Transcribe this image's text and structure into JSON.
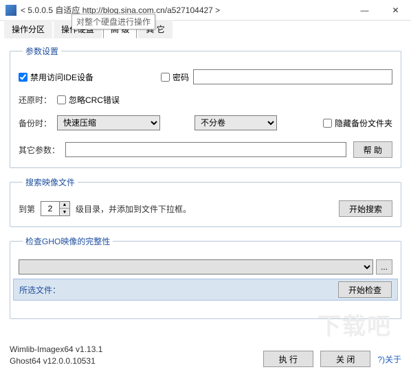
{
  "window": {
    "title": "< 5.0.0.5 自适应 http://blog.sina.com.cn/a527104427 >",
    "min": "—",
    "close": "✕"
  },
  "tabs": {
    "t1": "操作分区",
    "t2": "操作硬盘",
    "t3": "高 级",
    "t4": "其 它"
  },
  "tooltip": "对整个硬盘进行操作",
  "params": {
    "legend": "参数设置",
    "ide_label": "禁用访问IDE设备",
    "pwd_label": "密码",
    "restore_label": "还原时：",
    "crc_label": "忽略CRC错误",
    "backup_label": "备份时：",
    "compress": "快速压缩",
    "split": "不分卷",
    "hide_label": "隐藏备份文件夹",
    "other_label": "其它参数：",
    "help_btn": "帮 助"
  },
  "search": {
    "legend": "搜索映像文件",
    "prefix": "到第",
    "level": "2",
    "suffix": "级目录，并添加到文件下拉框。",
    "btn": "开始搜索"
  },
  "check": {
    "legend": "检查GHO映像的完整性",
    "selected_label": "所选文件：",
    "btn": "开始检查",
    "browse": "..."
  },
  "footer": {
    "v1": "Wimlib-Imagex64 v1.13.1",
    "v2": "Ghost64 v12.0.0.10531",
    "exec": "执 行",
    "close": "关 闭",
    "about": "?)关于"
  },
  "watermark": "下载吧"
}
